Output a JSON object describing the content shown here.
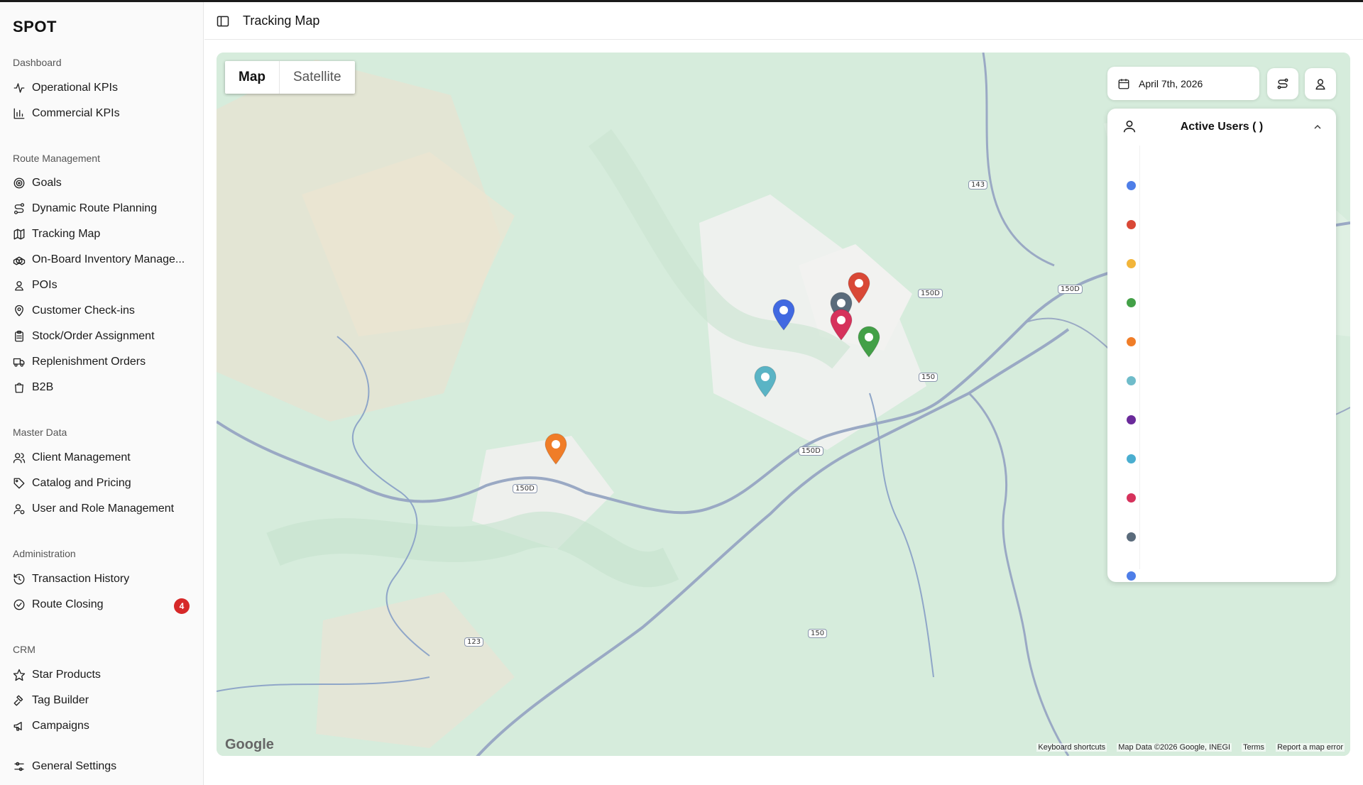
{
  "app": {
    "brand": "SPOT"
  },
  "header": {
    "title": "Tracking Map"
  },
  "sidebar": {
    "sections": [
      {
        "title": "Dashboard",
        "items": [
          {
            "label": "Operational KPIs",
            "icon": "activity-icon"
          },
          {
            "label": "Commercial KPIs",
            "icon": "bar-chart-icon"
          }
        ]
      },
      {
        "title": "Route Management",
        "items": [
          {
            "label": "Goals",
            "icon": "target-icon"
          },
          {
            "label": "Dynamic Route Planning",
            "icon": "route-icon"
          },
          {
            "label": "Tracking Map",
            "icon": "map-icon"
          },
          {
            "label": "On-Board Inventory Manage...",
            "icon": "boxes-icon"
          },
          {
            "label": "POIs",
            "icon": "user-pin-icon"
          },
          {
            "label": "Customer Check-ins",
            "icon": "map-pin-icon"
          },
          {
            "label": "Stock/Order Assignment",
            "icon": "clipboard-icon"
          },
          {
            "label": "Replenishment Orders",
            "icon": "truck-icon"
          },
          {
            "label": "B2B",
            "icon": "shopping-bag-icon"
          }
        ]
      },
      {
        "title": "Master Data",
        "items": [
          {
            "label": "Client Management",
            "icon": "users-icon"
          },
          {
            "label": "Catalog and Pricing",
            "icon": "tag-icon"
          },
          {
            "label": "User and Role Management",
            "icon": "user-cog-icon"
          }
        ]
      },
      {
        "title": "Administration",
        "items": [
          {
            "label": "Transaction History",
            "icon": "history-icon"
          },
          {
            "label": "Route Closing",
            "icon": "check-circle-icon",
            "badge": "4"
          }
        ]
      },
      {
        "title": "CRM",
        "items": [
          {
            "label": "Star Products",
            "icon": "star-icon"
          },
          {
            "label": "Tag Builder",
            "icon": "hammer-icon"
          },
          {
            "label": "Campaigns",
            "icon": "megaphone-icon"
          }
        ]
      }
    ],
    "footer_item": {
      "label": "General Settings",
      "icon": "settings-icon"
    }
  },
  "map": {
    "type_buttons": {
      "map": "Map",
      "satellite": "Satellite"
    },
    "date": "April 7th, 2026",
    "attribution": {
      "keyboard": "Keyboard shortcuts",
      "data": "Map Data ©2026 Google, INEGI",
      "terms": "Terms",
      "report": "Report a map error"
    },
    "logo": "Google",
    "road_labels": [
      "143",
      "150D",
      "150D",
      "150",
      "150D",
      "150D",
      "150",
      "123"
    ],
    "pins": [
      {
        "color": "#d94836"
      },
      {
        "color": "#4169e1"
      },
      {
        "color": "#5a6b7b"
      },
      {
        "color": "#d6325c"
      },
      {
        "color": "#43a047"
      },
      {
        "color": "#5ab4c5"
      },
      {
        "color": "#f07d28"
      }
    ]
  },
  "users_panel": {
    "title": "Active Users (   )",
    "dots": [
      "#4e7ee8",
      "#d94836",
      "#f2b53a",
      "#43a047",
      "#f07d28",
      "#6fbcca",
      "#6a2a9a",
      "#4aaed0",
      "#d6325c",
      "#5a6b7b",
      "#4e7ee8"
    ]
  }
}
